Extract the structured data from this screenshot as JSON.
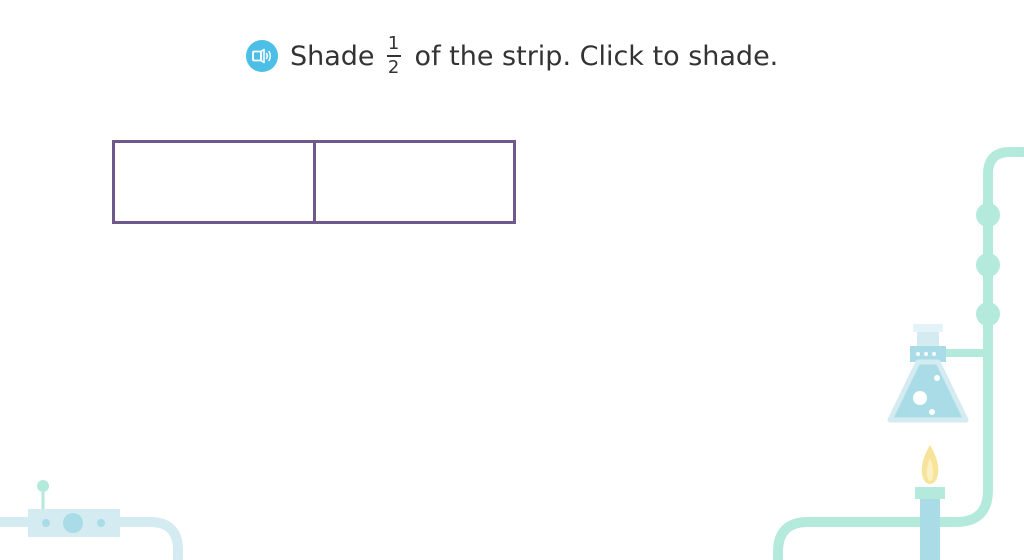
{
  "question": {
    "prefix": "Shade",
    "fraction_numerator": "1",
    "fraction_denominator": "2",
    "suffix": "of the strip. Click to shade.",
    "audio_icon": "speaker-icon"
  },
  "strip": {
    "parts": 2,
    "shaded_parts": 0,
    "border_color": "#6d5a8b"
  },
  "colors": {
    "accent_audio": "#4dbfe6",
    "lab_pipe": "#b4eadb",
    "lab_light_blue": "#d3ebf1",
    "flask_liquid": "#a9dce6",
    "flame": "#f7e49a"
  }
}
